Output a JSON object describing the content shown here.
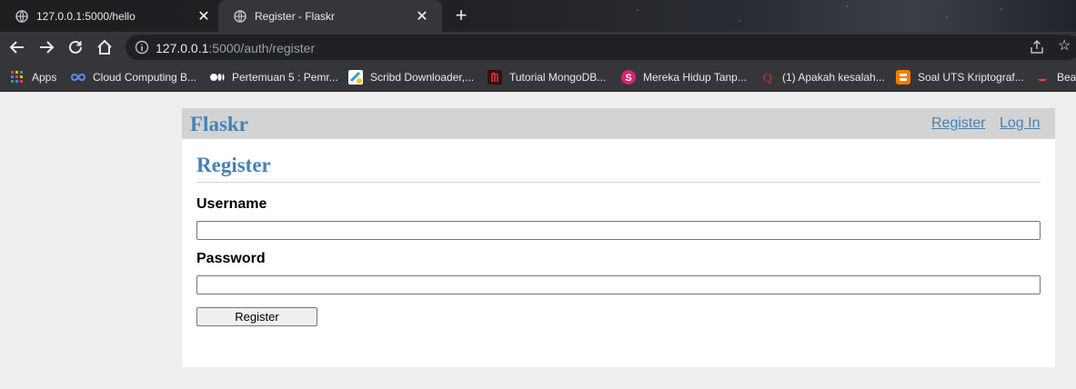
{
  "browser": {
    "tabs": [
      {
        "title": "127.0.0.1:5000/hello",
        "active": false
      },
      {
        "title": "Register - Flaskr",
        "active": true
      }
    ],
    "url": {
      "host": "127.0.0.1",
      "path": ":5000/auth/register"
    },
    "bookmarks": [
      {
        "label": "Apps",
        "icon": "apps-grid-icon"
      },
      {
        "label": "Cloud Computing B...",
        "icon": "infinity-icon"
      },
      {
        "label": "Pertemuan 5 : Pemr...",
        "icon": "medium-icon"
      },
      {
        "label": "Scribd Downloader,...",
        "icon": "scribd-icon"
      },
      {
        "label": "Tutorial MongoDB...",
        "icon": "mongodb-icon"
      },
      {
        "label": "Mereka Hidup Tanp...",
        "icon": "s-circle-icon"
      },
      {
        "label": "(1) Apakah kesalah...",
        "icon": "quora-icon"
      },
      {
        "label": "Soal UTS Kriptograf...",
        "icon": "blogger-icon"
      },
      {
        "label": "Beas",
        "icon": "bookmark-icon"
      }
    ]
  },
  "app": {
    "brand": "Flaskr",
    "nav": {
      "register": "Register",
      "login": "Log In"
    },
    "heading": "Register",
    "form": {
      "username_label": "Username",
      "username_value": "",
      "password_label": "Password",
      "password_value": "",
      "submit_label": "Register"
    }
  },
  "colors": {
    "accent": "#4682b4",
    "nav_bg": "#d3d3d3",
    "page_bg": "#eeeeee",
    "chrome_toolbar": "#35363a"
  }
}
